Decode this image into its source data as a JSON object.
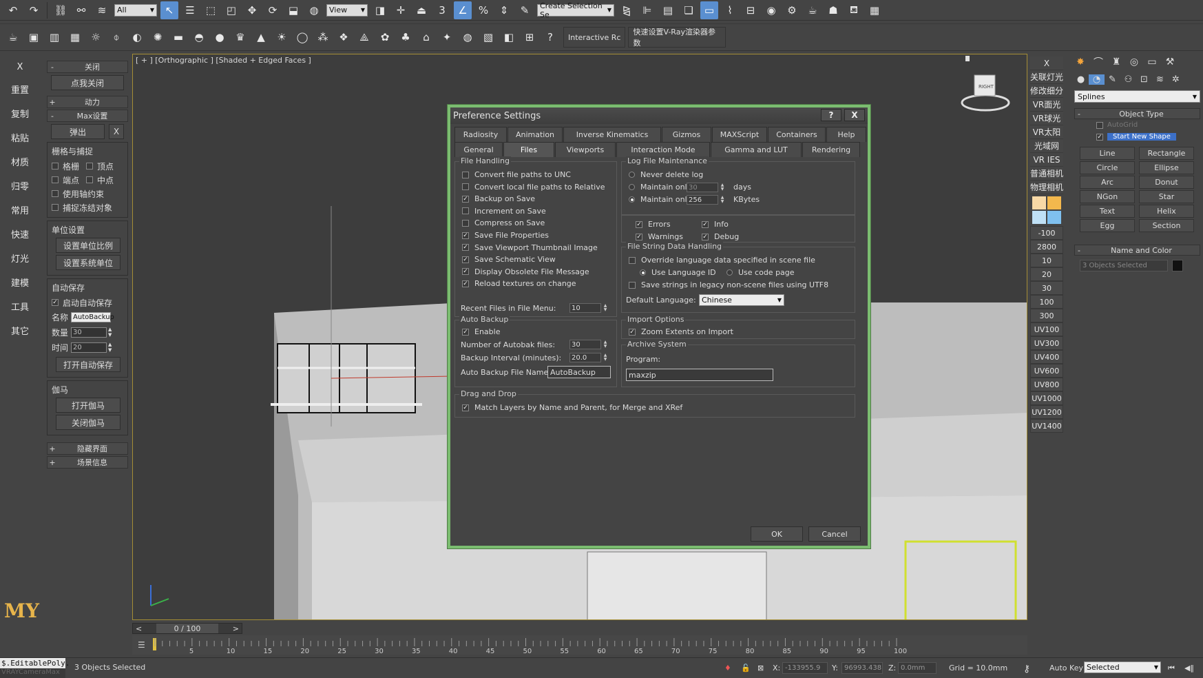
{
  "toolbar1": {
    "selection_filter": "All",
    "ref_coord": "View",
    "named_selection_placeholder": "Create Selection Se"
  },
  "toolbar2": {
    "interactive_label": "Interactive Rc",
    "vray_quick_label": "快速设置V-Ray渲染器参数"
  },
  "left_strip": {
    "close_x": "X",
    "items": [
      "重置",
      "复制",
      "粘贴",
      "材质",
      "归零",
      "常用",
      "快速",
      "灯光",
      "建模",
      "工具",
      "其它"
    ],
    "logo": "MY"
  },
  "left_panel": {
    "close_head": "关闭",
    "close_button": "点我关闭",
    "dynamics_head": "动力",
    "max_settings_head": "Max设置",
    "popout_button": "弹出",
    "popout_x": "X",
    "grid_snap_title": "栅格与捕捉",
    "snap_grid": "格栅",
    "snap_vertex": "顶点",
    "snap_endpoint": "端点",
    "snap_midpoint": "中点",
    "use_axis_constraint": "使用轴约束",
    "snap_frozen": "捕捉冻结对象",
    "unit_title": "单位设置",
    "set_unit_scale": "设置单位比例",
    "set_system_unit": "设置系统单位",
    "autosave_title": "自动保存",
    "enable_autosave": "启动自动保存",
    "name_label": "名称",
    "name_value": "AutoBackup",
    "count_label": "数量",
    "count_value": "30",
    "time_label": "时间",
    "time_value": "20",
    "open_autosave": "打开自动保存",
    "gamma_title": "伽马",
    "open_gamma": "打开伽马",
    "close_gamma": "关闭伽马",
    "hide_ui_head": "隐藏界面",
    "scene_info_head": "场景信息"
  },
  "viewport": {
    "label": "[ + ] [Orthographic ] [Shaded + Edged Faces ]",
    "viewcube_face": "RIGHT"
  },
  "right_labels": {
    "close_x": "X",
    "items": [
      "关联灯光",
      "修改细分",
      "VR面光",
      "VR球光",
      "VR太阳",
      "光域网",
      "VR IES",
      "普通相机",
      "物理相机"
    ],
    "swatches": [
      "#f8d9a6",
      "#f3b84d",
      "#bfe0f5",
      "#7fc0ef"
    ],
    "numbers": [
      "-100",
      "2800",
      "10",
      "20",
      "30",
      "100",
      "300",
      "UV100",
      "UV300",
      "UV400",
      "UV600",
      "UV800",
      "UV1000",
      "UV1200",
      "UV1400"
    ]
  },
  "command_panel": {
    "category_dropdown": "Splines",
    "object_type_head": "Object Type",
    "autogrid": "AutoGrid",
    "start_new_shape": "Start New Shape",
    "shape_buttons": [
      "Line",
      "Rectangle",
      "Circle",
      "Ellipse",
      "Arc",
      "Donut",
      "NGon",
      "Star",
      "Text",
      "Helix",
      "Egg",
      "Section"
    ],
    "name_color_head": "Name and Color",
    "name_field": "3 Objects Selected"
  },
  "dialog": {
    "title": "Preference Settings",
    "help_btn": "?",
    "close_btn": "X",
    "tabs_row1": [
      "Radiosity",
      "Animation",
      "Inverse Kinematics",
      "Gizmos",
      "MAXScript",
      "Containers",
      "Help"
    ],
    "tabs_row2": [
      "General",
      "Files",
      "Viewports",
      "Interaction Mode",
      "Gamma and LUT",
      "Rendering"
    ],
    "active_tab": "Files",
    "file_handling": {
      "title": "File Handling",
      "options": [
        {
          "label": "Convert file paths to UNC",
          "checked": false
        },
        {
          "label": "Convert local file paths to Relative",
          "checked": false
        },
        {
          "label": "Backup on Save",
          "checked": true
        },
        {
          "label": "Increment on Save",
          "checked": false
        },
        {
          "label": "Compress on Save",
          "checked": false
        },
        {
          "label": "Save File Properties",
          "checked": true
        },
        {
          "label": "Save Viewport Thumbnail Image",
          "checked": true
        },
        {
          "label": "Save Schematic View",
          "checked": true
        },
        {
          "label": "Display Obsolete File Message",
          "checked": true
        },
        {
          "label": "Reload textures on change",
          "checked": true
        }
      ],
      "recent_files_label": "Recent Files in File Menu:",
      "recent_files_value": "10"
    },
    "log_file": {
      "title": "Log File Maintenance",
      "never_delete": "Never delete log",
      "maintain_only": "Maintain only",
      "days_value": "30",
      "days_unit": "days",
      "kbytes_value": "256",
      "kbytes_unit": "KBytes",
      "errors": "Errors",
      "info": "Info",
      "warnings": "Warnings",
      "debug": "Debug"
    },
    "file_string": {
      "title": "File String Data Handling",
      "override": "Override language data specified in scene file",
      "use_language_id": "Use Language ID",
      "use_code_page": "Use code page",
      "save_strings_utf8": "Save strings in legacy non-scene files using UTF8",
      "default_language_label": "Default Language:",
      "default_language_value": "Chinese"
    },
    "auto_backup": {
      "title": "Auto Backup",
      "enable": "Enable",
      "num_files_label": "Number of Autobak files:",
      "num_files_value": "30",
      "interval_label": "Backup Interval (minutes):",
      "interval_value": "20.0",
      "file_name_label": "Auto Backup File Name:",
      "file_name_value": "AutoBackup"
    },
    "import_options": {
      "title": "Import Options",
      "zoom_extents": "Zoom Extents on Import"
    },
    "archive": {
      "title": "Archive System",
      "program_label": "Program:",
      "program_value": "maxzip"
    },
    "drag_drop": {
      "title": "Drag and Drop",
      "match_layers": "Match Layers by Name and Parent, for Merge and XRef"
    },
    "ok": "OK",
    "cancel": "Cancel"
  },
  "timeline": {
    "frame_display": "0 / 100",
    "prev": "<",
    "next": ">",
    "ticks": [
      "5",
      "10",
      "15",
      "20",
      "25",
      "30",
      "35",
      "40",
      "45",
      "50",
      "55",
      "60",
      "65",
      "70",
      "75",
      "80",
      "85",
      "90",
      "95",
      "100"
    ]
  },
  "status": {
    "maxscript_line": "$.EditablePoly.",
    "maxscript_line2": "VRAYCameraMax",
    "selection_text": "3 Objects Selected",
    "x_label": "X:",
    "x_value": "-133955.9",
    "y_label": "Y:",
    "y_value": "96993.438",
    "z_label": "Z:",
    "z_value": "0.0mm",
    "grid": "Grid = 10.0mm",
    "auto_key": "Auto Key",
    "key_filter": "Selected"
  }
}
